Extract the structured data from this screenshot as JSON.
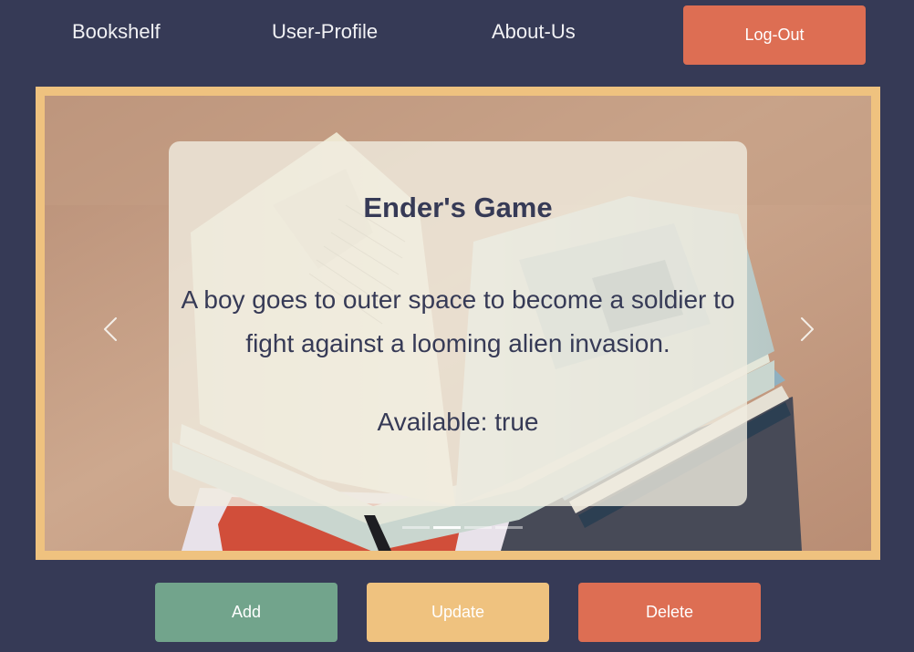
{
  "nav": {
    "bookshelf": "Bookshelf",
    "user_profile": "User-Profile",
    "about_us": "About-Us",
    "logout": "Log-Out"
  },
  "colors": {
    "background": "#363a56",
    "logout": "#dd6e53",
    "frame": "#efc27f",
    "add": "#72a48c",
    "update": "#efc27f",
    "delete": "#dd6e53"
  },
  "carousel": {
    "slide_count": 4,
    "active_index": 1,
    "book": {
      "title": "Ender's Game",
      "description": "A boy goes to outer space to become a soldier to fight against a looming alien invasion.",
      "availability": "Available: true"
    },
    "icons": {
      "prev": "chevron-left-icon",
      "next": "chevron-right-icon"
    }
  },
  "actions": {
    "add": "Add",
    "update": "Update",
    "delete": "Delete"
  }
}
